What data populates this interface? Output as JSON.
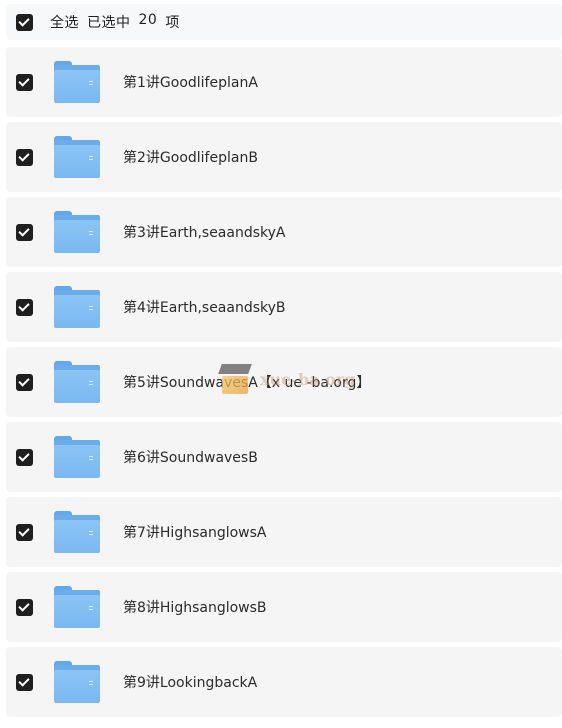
{
  "header": {
    "select_all_label": "全选",
    "selected_prefix": "已选中",
    "selected_count": "20",
    "selected_suffix": "项"
  },
  "items": [
    {
      "name": "第1讲GoodlifeplanA"
    },
    {
      "name": "第2讲GoodlifeplanB"
    },
    {
      "name": "第3讲Earth,seaandskyA"
    },
    {
      "name": "第4讲Earth,seaandskyB"
    },
    {
      "name": "第5讲SoundwavesA【x ue -ba.org】"
    },
    {
      "name": "第6讲SoundwavesB"
    },
    {
      "name": "第7讲HighsanglowsA"
    },
    {
      "name": "第8讲HighsanglowsB"
    },
    {
      "name": "第9讲LookingbackA"
    }
  ],
  "icons": {
    "checkbox": "checkbox-checked-icon",
    "folder": "folder-icon"
  },
  "watermark_text": "xue-ba.org"
}
